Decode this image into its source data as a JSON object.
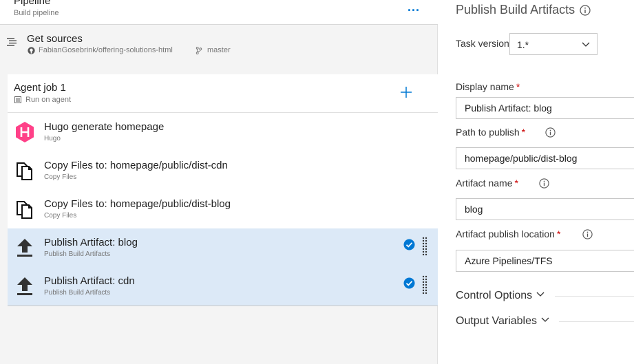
{
  "pipeline": {
    "title": "Pipeline",
    "subtitle": "Build pipeline",
    "more": "..."
  },
  "get_sources": {
    "title": "Get sources",
    "repo": "FabianGosebrink/offering-solutions-html",
    "branch": "master"
  },
  "agent_job": {
    "title": "Agent job 1",
    "subtitle": "Run on agent"
  },
  "tasks": [
    {
      "title": "Hugo generate homepage",
      "subtitle": "Hugo",
      "icon": "hugo-icon",
      "selected": false
    },
    {
      "title": "Copy Files to: homepage/public/dist-cdn",
      "subtitle": "Copy Files",
      "icon": "copy-files-icon",
      "selected": false
    },
    {
      "title": "Copy Files to: homepage/public/dist-blog",
      "subtitle": "Copy Files",
      "icon": "copy-files-icon",
      "selected": false
    },
    {
      "title": "Publish Artifact: blog",
      "subtitle": "Publish Build Artifacts",
      "icon": "upload-icon",
      "selected": true
    },
    {
      "title": "Publish Artifact: cdn",
      "subtitle": "Publish Build Artifacts",
      "icon": "upload-icon",
      "selected": true
    }
  ],
  "details": {
    "title": "Publish Build Artifacts",
    "task_version_label": "Task version",
    "task_version_value": "1.*",
    "display_name_label": "Display name",
    "display_name_value": "Publish Artifact: blog",
    "path_label": "Path to publish",
    "path_value": "homepage/public/dist-blog",
    "artifact_name_label": "Artifact name",
    "artifact_name_value": "blog",
    "location_label": "Artifact publish location",
    "location_value": "Azure Pipelines/TFS",
    "required_mark": "*",
    "control_options": "Control Options",
    "output_variables": "Output Variables"
  },
  "colors": {
    "accent": "#0078d4",
    "selected_row": "#dce9f7",
    "hugo": "#ff4088",
    "required": "#cc0000"
  }
}
